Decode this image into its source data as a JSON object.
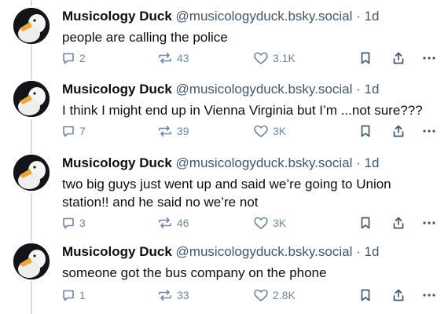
{
  "posts": [
    {
      "author": "Musicology Duck",
      "handle": "@musicologyduck.bsky.social",
      "separator": "·",
      "time": "1d",
      "text": "people are calling the police",
      "replies": "2",
      "reposts": "43",
      "likes": "3.1K"
    },
    {
      "author": "Musicology Duck",
      "handle": "@musicologyduck.bsky.social",
      "separator": "·",
      "time": "1d",
      "text": "I think I might end up in Vienna Virginia but I’m ...not sure???",
      "replies": "7",
      "reposts": "39",
      "likes": "3K"
    },
    {
      "author": "Musicology Duck",
      "handle": "@musicologyduck.bsky.social",
      "separator": "·",
      "time": "1d",
      "text": "two big guys just went up and said we’re going to Union station!! and he said no we’re not",
      "replies": "3",
      "reposts": "46",
      "likes": "3K"
    },
    {
      "author": "Musicology Duck",
      "handle": "@musicologyduck.bsky.social",
      "separator": "·",
      "time": "1d",
      "text": "someone got the bus company on the phone",
      "replies": "1",
      "reposts": "33",
      "likes": "2.8K"
    }
  ],
  "icons": [
    "reply-icon",
    "repost-icon",
    "like-icon",
    "bookmark-icon",
    "share-icon",
    "more-icon"
  ],
  "colors": {
    "text": "#0b0f14",
    "muted": "#42576c",
    "action": "#6f869f",
    "thread_line": "#d4dbe2"
  }
}
